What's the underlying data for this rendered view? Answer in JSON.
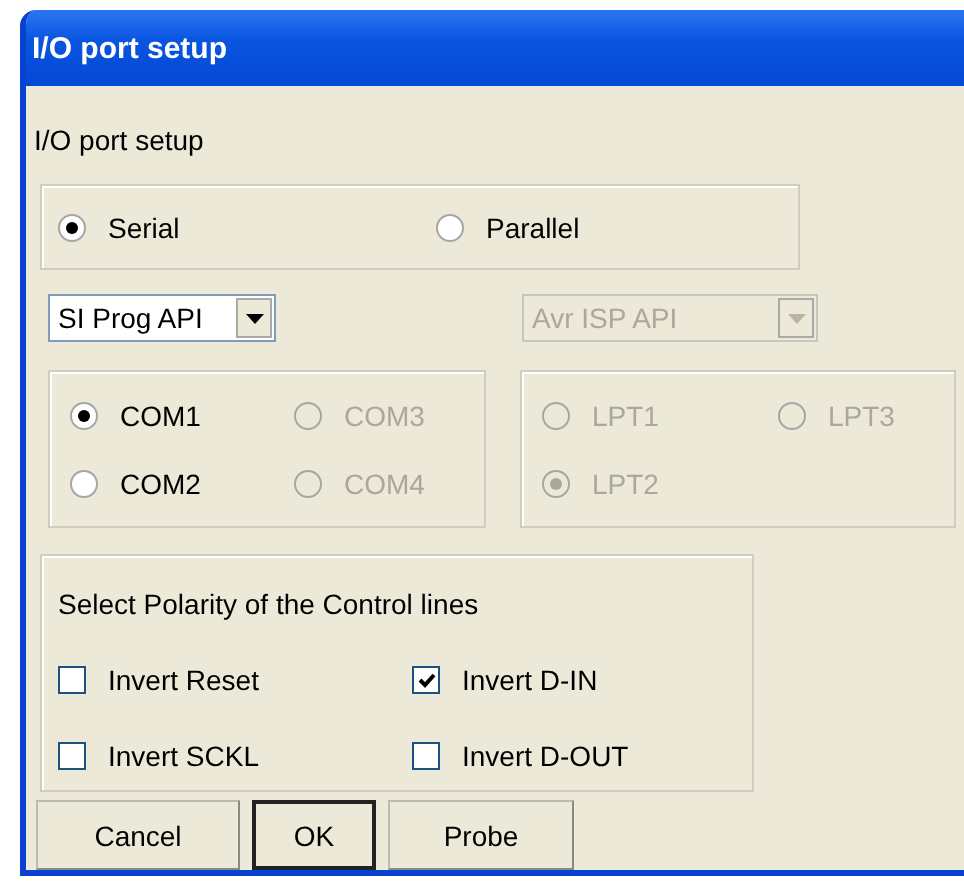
{
  "window": {
    "title": "I/O port setup"
  },
  "heading": "I/O port setup",
  "port_types": [
    {
      "label": "Serial",
      "selected": true
    },
    {
      "label": "Parallel",
      "selected": false
    }
  ],
  "dropdowns": [
    {
      "value": "SI Prog API",
      "disabled": false
    },
    {
      "value": "Avr ISP API",
      "disabled": true
    }
  ],
  "com_ports": [
    {
      "label": "COM1",
      "selected": true,
      "disabled": false
    },
    {
      "label": "COM3",
      "selected": false,
      "disabled": true
    },
    {
      "label": "COM2",
      "selected": false,
      "disabled": false
    },
    {
      "label": "COM4",
      "selected": false,
      "disabled": true
    }
  ],
  "lpt_ports": [
    {
      "label": "LPT1",
      "selected": false,
      "disabled": true
    },
    {
      "label": "LPT3",
      "selected": false,
      "disabled": true
    },
    {
      "label": "LPT2",
      "selected": true,
      "disabled": true
    }
  ],
  "polarity": {
    "title": "Select Polarity of the Control lines",
    "options": [
      {
        "label": "Invert Reset",
        "checked": false
      },
      {
        "label": "Invert D-IN",
        "checked": true
      },
      {
        "label": "Invert SCKL",
        "checked": false
      },
      {
        "label": "Invert D-OUT",
        "checked": false
      }
    ]
  },
  "buttons": [
    {
      "label": "Cancel",
      "default": false
    },
    {
      "label": "OK",
      "default": true
    },
    {
      "label": "Probe",
      "default": false
    }
  ]
}
